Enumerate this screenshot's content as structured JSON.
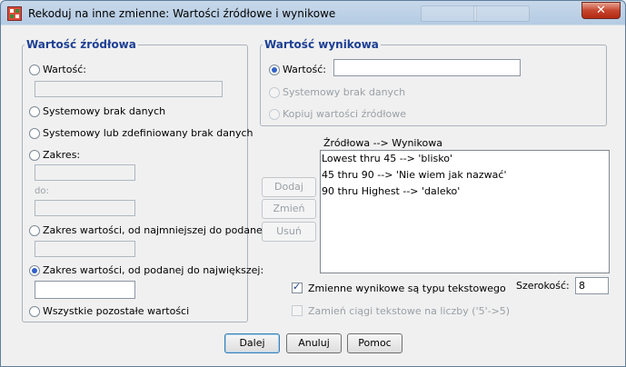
{
  "window": {
    "title": "Rekoduj na inne zmienne: Wartości źródłowe i wynikowe",
    "close_glyph": "✕"
  },
  "source": {
    "legend": "Wartość źródłowa",
    "value_label": "Wartość:",
    "system_missing_label": "Systemowy brak danych",
    "system_or_user_missing_label": "Systemowy lub zdefiniowany brak danych",
    "range_label": "Zakres:",
    "range_to_label": "do:",
    "range_lowest_label": "Zakres wartości, od najmniejszej do podanej:",
    "range_highest_label": "Zakres wartości, od podanej do największej:",
    "all_other_label": "Wszystkie pozostałe wartości",
    "selected_option": "range_highest"
  },
  "target": {
    "legend": "Wartość wynikowa",
    "value_label": "Wartość:",
    "value_input": "",
    "system_missing_label": "Systemowy brak danych",
    "copy_label": "Kopiuj wartości źródłowe",
    "selected_option": "value"
  },
  "mapping": {
    "header": "Źródłowa --> Wynikowa",
    "items": [
      "Lowest thru 45 --> 'blisko'",
      "45 thru 90 --> 'Nie wiem jak nazwać'",
      "90 thru Highest --> 'daleko'"
    ],
    "add_label": "Dodaj",
    "change_label": "Zmień",
    "remove_label": "Usuń"
  },
  "options": {
    "string_output_label": "Zmienne wynikowe są typu tekstowego",
    "string_output_checked": true,
    "width_label": "Szerokość:",
    "width_value": "8",
    "convert_numeric_label": "Zamień ciągi tekstowe na liczby ('5'->5)",
    "convert_numeric_checked": false
  },
  "footer": {
    "continue_label": "Dalej",
    "cancel_label": "Anuluj",
    "help_label": "Pomoc"
  },
  "colors": {
    "legend_text": "#1c3f94",
    "radio_dot": "#3361c7",
    "close_button": "#c7452e"
  }
}
